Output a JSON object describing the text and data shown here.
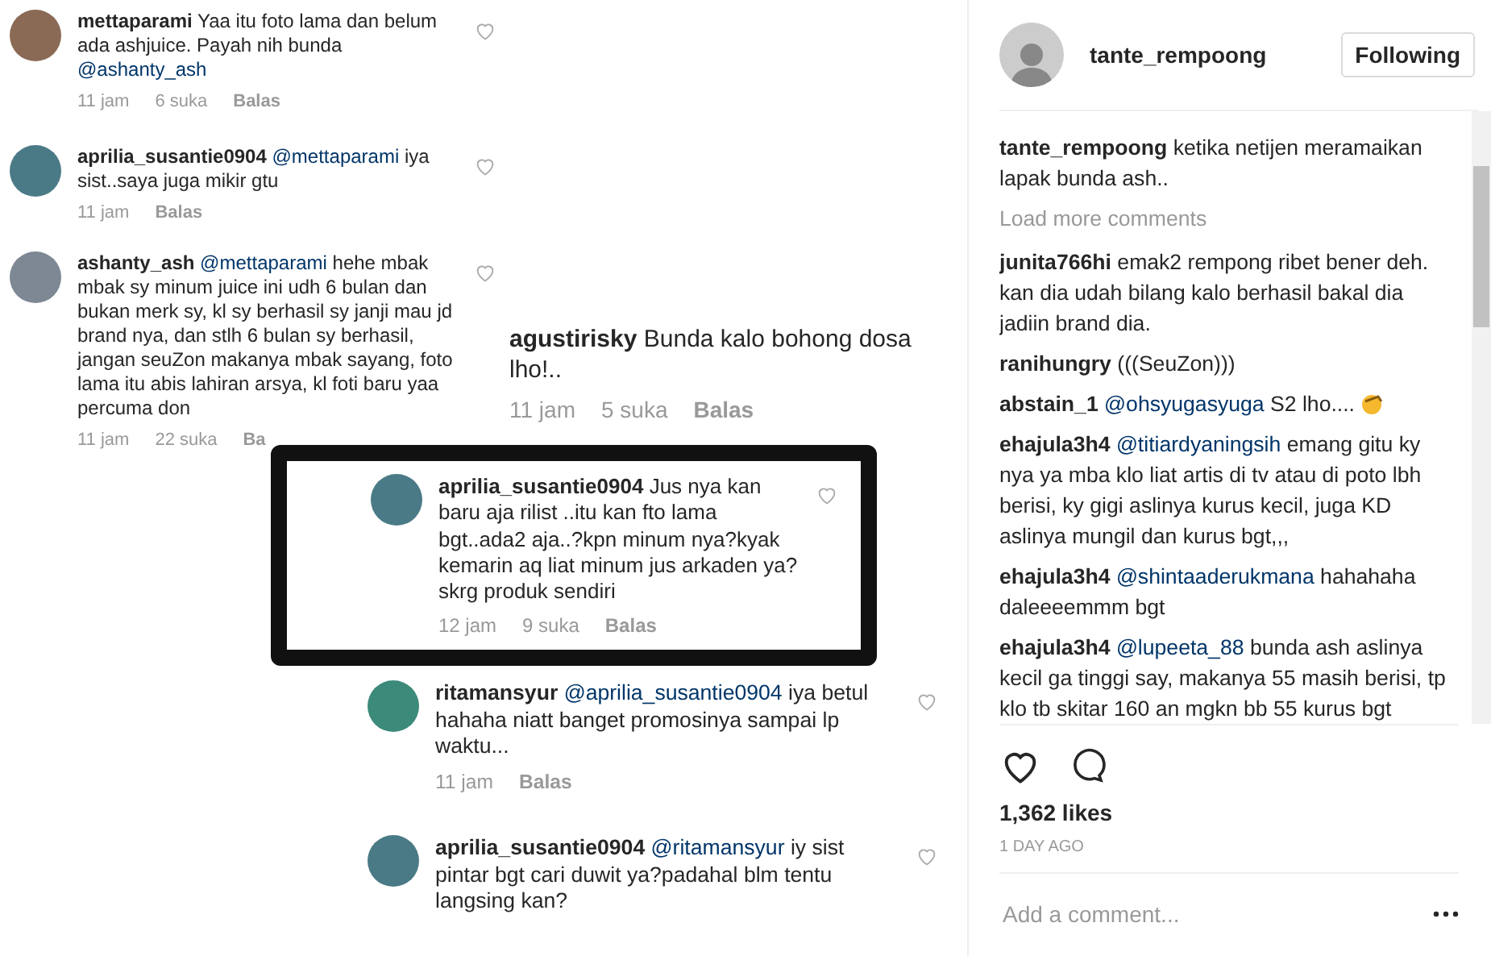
{
  "post_image": {
    "comments": [
      {
        "user": "mettaparami",
        "text": "Yaa itu foto lama dan belum ada ashjuice. Payah nih bunda",
        "trailing_mention": "@ashanty_ash",
        "time": "11 jam",
        "likes": "6 suka",
        "reply": "Balas",
        "framed": false
      },
      {
        "user": "aprilia_susantie0904",
        "mention": "@mettaparami",
        "text": "iya sist..saya juga mikir gtu",
        "time": "11 jam",
        "reply": "Balas",
        "framed": false
      },
      {
        "user": "ashanty_ash",
        "mention": "@mettaparami",
        "text": "hehe mbak mbak sy minum juice ini udh 6 bulan dan bukan merk sy, kl sy berhasil sy janji mau jd brand nya, dan stlh 6 bulan sy berhasil, jangan seuZon makanya mbak sayang, foto lama itu abis lahiran arsya, kl foti baru yaa percuma don",
        "time": "11 jam",
        "likes": "22 suka",
        "reply": "Ba",
        "framed": false
      },
      {
        "user": "agustirisky",
        "text": "Bunda kalo bohong dosa lho!..",
        "time": "11 jam",
        "likes": "5 suka",
        "reply": "Balas",
        "framed": false
      },
      {
        "user": "aprilia_susantie0904",
        "text": "Jus nya kan baru aja rilist ..itu kan fto lama bgt..ada2 aja..?kpn minum nya?kyak kemarin aq liat minum jus arkaden ya?skrg produk sendiri",
        "time": "12 jam",
        "likes": "9 suka",
        "reply": "Balas",
        "framed": true
      },
      {
        "user": "ritamansyur",
        "mention": "@aprilia_susantie0904",
        "text": "iya betul hahaha niatt banget promosinya sampai lp waktu...",
        "time": "11 jam",
        "reply": "Balas",
        "framed": false
      },
      {
        "user": "aprilia_susantie0904",
        "mention": "@ritamansyur",
        "text": "iy sist pintar bgt cari duwit ya?padahal blm tentu langsing kan?",
        "framed": false
      }
    ]
  },
  "header": {
    "username": "tante_rempoong",
    "follow_button": "Following"
  },
  "caption": {
    "user": "tante_rempoong",
    "text": "ketika netijen meramaikan lapak bunda ash.."
  },
  "load_more": "Load more comments",
  "comments": [
    {
      "user": "junita766hi",
      "text": "emak2 rempong ribet bener deh. kan dia udah bilang kalo berhasil bakal dia jadiin brand dia.",
      "emoji": false
    },
    {
      "user": "ranihungry",
      "text": "(((SeuZon)))",
      "emoji": false
    },
    {
      "user": "abstain_1",
      "mention": "@ohsyugasyuga",
      "text": "S2 lho....",
      "emoji": true
    },
    {
      "user": "ehajula3h4",
      "mention": "@titiardyaningsih",
      "text": "emang gitu ky nya ya mba klo liat artis di tv atau di poto lbh berisi, ky gigi aslinya kurus kecil, juga KD aslinya mungil dan kurus bgt,,,",
      "emoji": false
    },
    {
      "user": "ehajula3h4",
      "mention": "@shintaaderukmana",
      "text": "hahahaha daleeeemmm bgt",
      "emoji": false
    },
    {
      "user": "ehajula3h4",
      "mention": "@lupeeta_88",
      "text": "bunda ash aslinya kecil ga tinggi say, makanya 55 masih berisi, tp klo tb skitar 160 an mgkn bb 55 kurus bgt",
      "emoji": false
    }
  ],
  "likes": "1,362 likes",
  "date": "1 DAY AGO",
  "add_comment": {
    "placeholder": "Add a comment..."
  }
}
